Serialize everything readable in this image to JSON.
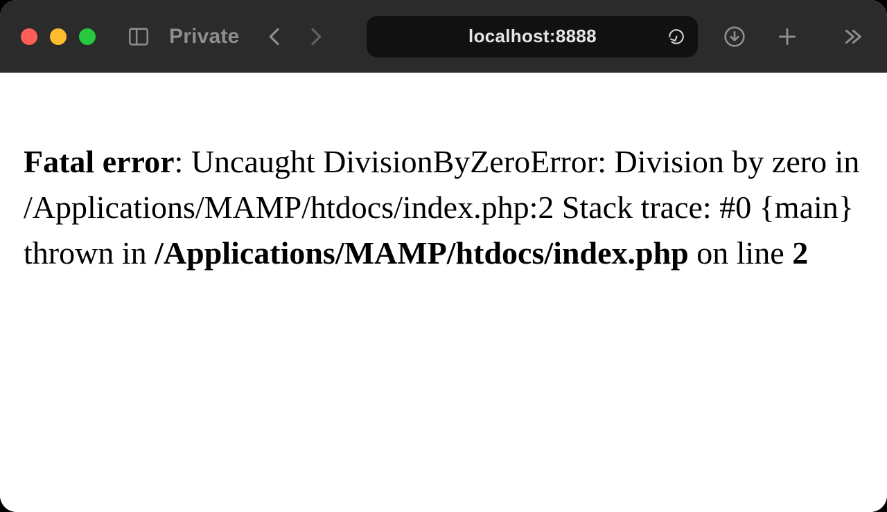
{
  "toolbar": {
    "private_label": "Private",
    "url": "localhost:8888"
  },
  "error": {
    "label": "Fatal error",
    "sep": ": ",
    "message": "Uncaught DivisionByZeroError: Division by zero in /Applications/MAMP/htdocs/index.php:2 Stack trace: #0 {main} thrown in ",
    "file": "/Applications/MAMP/htdocs/index.php",
    "connector": " on line ",
    "line": "2"
  }
}
